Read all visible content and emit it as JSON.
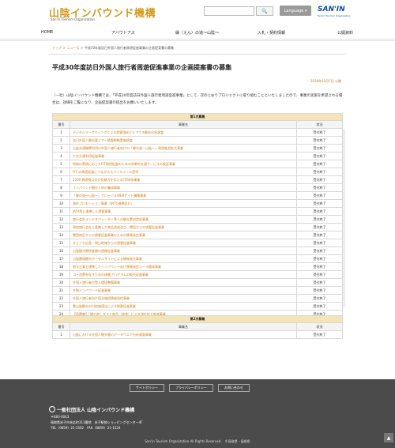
{
  "header": {
    "logo_title": "山陰インバウンド機構",
    "logo_sub": "San'in Tourism Organization",
    "search_button": "🔍",
    "language_label": "Language ▾",
    "brand_name": "SAN'IN",
    "brand_sub": "San'in Tourism Organization"
  },
  "nav": {
    "items": [
      "HOME",
      "アバウトアス",
      "縁（えん）の道〜山陰〜",
      "入札・契約情報",
      "公開資料"
    ]
  },
  "breadcrumb": {
    "home": "トップ",
    "sep": "＞",
    "news": "ニュース",
    "current": "平成30年度訪日外国人旅行者周遊促進事業の企画提案書の募集"
  },
  "page": {
    "title": "平成30年度訪日外国人旅行者周遊促進事業の企画提案書の募集",
    "date": "2018年12月7日 公開",
    "intro": "（一社）山陰インバウンド機構では、「平成30年度訪日外国人旅行者周遊促進事業」として、次のとおりプロジェクトに取り組むことといたしましたので、事業の実施を希望される場合は、詳細をご覧になり、企画提案書の提出をお願いいたします。"
  },
  "table1": {
    "section": "第1次募集",
    "col_no": "番号",
    "col_name": "事業名",
    "col_status": "状況",
    "rows": [
      {
        "no": "1",
        "name": "デジタルマーケティングによる誘客強化とヒアクス動向分析調査",
        "status": "受付終了"
      },
      {
        "no": "2",
        "name": "訪日外国人観光客ツアー誘客戦略実施調査",
        "status": "受付終了"
      },
      {
        "no": "3",
        "name": "山陰交通機関利用の外国人旅行者向けの「縁の道〜山陰〜」周遊推奨拡大事業",
        "status": "受付終了"
      },
      {
        "no": "4",
        "name": "二次交通利用促進事業",
        "status": "受付終了"
      },
      {
        "no": "5",
        "name": "地域の実情に応じたFIT周遊促進のための効果的交通サービスの検証事業",
        "status": "受付終了"
      },
      {
        "no": "6",
        "name": "FIT の周遊促進につながるモバイルツール提供",
        "status": "受付終了"
      },
      {
        "no": "7",
        "name": "1200 周遊拠点の文化魅力を伝えるFIT研修事業",
        "status": "受付終了"
      },
      {
        "no": "8",
        "name": "インバウンド観光人材の養成事業",
        "status": "受付終了"
      },
      {
        "no": "9",
        "name": "「縁の道〜山陰〜」グローバルWEBサイト構築事業",
        "status": "受付終了"
      },
      {
        "no": "10",
        "name": "海外プロモーション事業（JNTO連携含む）",
        "status": "受付終了"
      },
      {
        "no": "11",
        "name": "JATA等と連携した誘客事業",
        "status": "受付終了"
      },
      {
        "no": "12",
        "name": "旅行会社ランドオペレーター等への観光素材造成事業",
        "status": "受付終了"
      },
      {
        "no": "13",
        "name": "現地旅行会社と連携した商品造成及び、関西からの誘客促進事業",
        "status": "受付終了"
      },
      {
        "no": "14",
        "name": "関西地区からの誘客促進事業のための情報発信事業",
        "status": "受付終了"
      },
      {
        "no": "15",
        "name": "せとうち広島・岡山地域からの誘客促進事業",
        "status": "受付終了"
      },
      {
        "no": "16",
        "name": "山陰観光関係者間の連携促進事業",
        "status": "受付終了"
      },
      {
        "no": "17",
        "name": "山陰圏域観光ポータルサイトによる情報発信事業",
        "status": "受付終了"
      },
      {
        "no": "18",
        "name": "地元企業と連携したインバウンド向け情報発信ツール開発事業",
        "status": "受付終了"
      },
      {
        "no": "19",
        "name": "コト消費を促すための体験プログラムの販売促進事業",
        "status": "受付終了"
      },
      {
        "no": "20",
        "name": "外国人旅行者の受入環境整備事業",
        "status": "受付終了"
      },
      {
        "no": "21",
        "name": "冬期インバウンド促進事業",
        "status": "受付終了"
      },
      {
        "no": "22",
        "name": "外国人旅行者向け宿泊施設情報発信事業",
        "status": "受付終了"
      },
      {
        "no": "23",
        "name": "豊山陰観光の付加価値化による誘客促進事業",
        "status": "受付終了"
      },
      {
        "no": "24",
        "name": "【再募集】「縁の道」ギフト商品（発券）による滞在拡大推進事業",
        "status": "受付終了"
      }
    ]
  },
  "table2": {
    "section": "第2次募集",
    "col_no": "番号",
    "col_name": "事業名",
    "col_status": "状況",
    "rows": [
      {
        "no": "1",
        "name": "山陰における外国人観光客のデータウエア分析調査事業",
        "status": "受付終了"
      }
    ]
  },
  "footer": {
    "links": [
      "サイトポリシー",
      "プライバシーポリシー",
      "お問い合わせ"
    ],
    "org": "一般社団法人 山陰インバウンド機構",
    "addr1": "〒683-0043",
    "addr2": "鳥取県米子市末広町311番地　米子駅前ショッピングセンター4F",
    "addr3": "TEL（0859）21-1502　FAX（0859）21-1524",
    "copyright": "San'in Tourism Organization All Rights Reserved.　©鳥取県・島根県",
    "to_top": "▲"
  }
}
